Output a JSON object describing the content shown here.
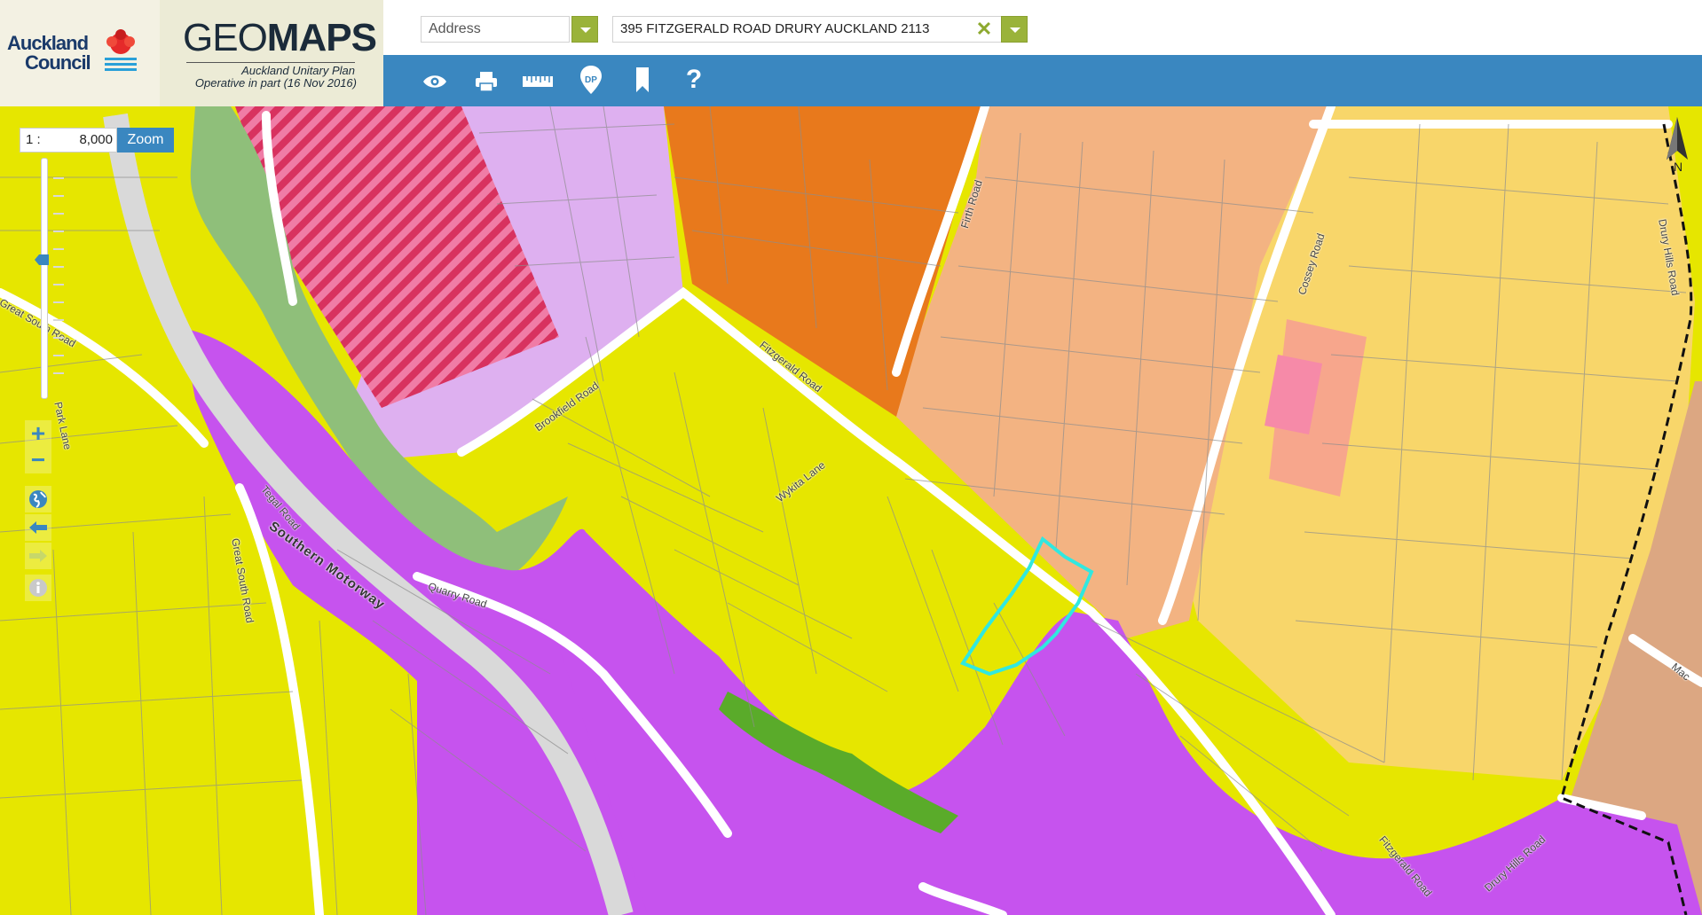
{
  "header": {
    "council_line1": "Auckland",
    "council_line2": "Council",
    "brand_geo": "GEO",
    "brand_maps": "MAPS",
    "plan_name": "Auckland Unitary Plan",
    "plan_sub": "Operative in part (16 Nov 2016)"
  },
  "search": {
    "type_value": "Address",
    "address_value": "395 FITZGERALD ROAD DRURY AUCKLAND 2113",
    "clear_glyph": "✕"
  },
  "toolbar": {
    "icons": [
      "eye-icon",
      "print-icon",
      "ruler-icon",
      "dp-pin-icon",
      "bookmark-icon",
      "help-icon"
    ],
    "dp_text": "DP",
    "help_text": "?"
  },
  "scale": {
    "prefix": "1 :",
    "value": "8,000",
    "zoom_label": "Zoom"
  },
  "nav": {
    "zoom_in": "+",
    "zoom_out": "−"
  },
  "north": {
    "label": "N"
  },
  "roads": [
    {
      "name": "Brookfield Road"
    },
    {
      "name": "Fitzgerald Road"
    },
    {
      "name": "Firth Road"
    },
    {
      "name": "Cossey Road"
    },
    {
      "name": "Drury Hills Road"
    },
    {
      "name": "Wykita Lane"
    },
    {
      "name": "Quarry Road"
    },
    {
      "name": "Southern Motorway"
    },
    {
      "name": "Great South Road"
    },
    {
      "name": "Tegal Road"
    },
    {
      "name": "Park Lane"
    },
    {
      "name": "Great South Road"
    },
    {
      "name": "Fitzgerald Road"
    },
    {
      "name": "Drury Hills Road"
    },
    {
      "name": "Mac"
    }
  ],
  "colors": {
    "rural_yellow": "#e6e600",
    "industrial_purple": "#c653ee",
    "business_orange": "#e8791c",
    "residential_peach": "#f3b382",
    "future_urban": "#f8d66a",
    "open_space_green": "#8fbf7a",
    "lilac": "#deb0f0",
    "pink_hatch": "#ee5c8c",
    "toolbar_blue": "#3a87c0",
    "highlight_cyan": "#30e8e0"
  }
}
